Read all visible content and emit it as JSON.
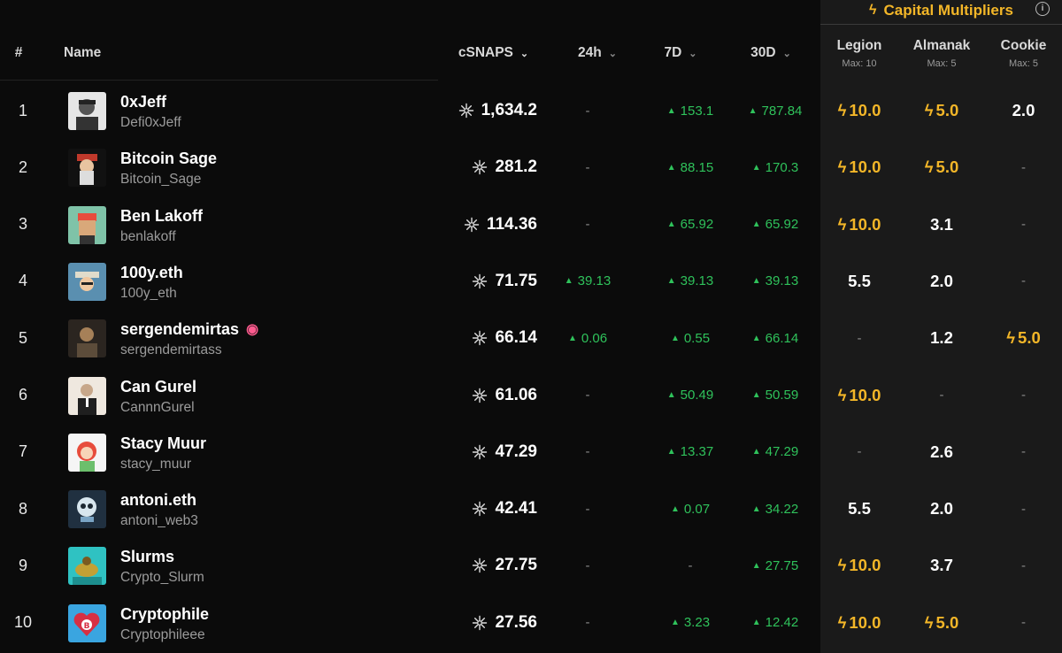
{
  "capital_multipliers": {
    "title": "Capital Multipliers",
    "info_icon": "info-icon",
    "bolt_icon": "lightning-bolt-icon"
  },
  "header": {
    "rank": "#",
    "name": "Name",
    "csnaps": "cSNAPS",
    "h24": "24h",
    "d7": "7D",
    "d30": "30D",
    "legion": "Legion",
    "legion_max": "Max: 10",
    "almanak": "Almanak",
    "almanak_max": "Max: 5",
    "cookie": "Cookie",
    "cookie_max": "Max: 5"
  },
  "colors": {
    "accent": "#f3b628",
    "positive": "#2fc25b",
    "panel": "#1a1a1a",
    "background": "#0b0b0b"
  },
  "rows": [
    {
      "rank": "1",
      "name": "0xJeff",
      "handle": "Defi0xJeff",
      "badge": "",
      "csnaps": "1,634.2",
      "h24": "-",
      "d7": "153.1",
      "d30": "787.84",
      "legion": "10.0",
      "legion_boost": true,
      "almanak": "5.0",
      "almanak_boost": true,
      "cookie": "2.0",
      "cookie_boost": false
    },
    {
      "rank": "2",
      "name": "Bitcoin Sage",
      "handle": "Bitcoin_Sage",
      "badge": "",
      "csnaps": "281.2",
      "h24": "-",
      "d7": "88.15",
      "d30": "170.3",
      "legion": "10.0",
      "legion_boost": true,
      "almanak": "5.0",
      "almanak_boost": true,
      "cookie": "-",
      "cookie_boost": false
    },
    {
      "rank": "3",
      "name": "Ben Lakoff",
      "handle": "benlakoff",
      "badge": "",
      "csnaps": "114.36",
      "h24": "-",
      "d7": "65.92",
      "d30": "65.92",
      "legion": "10.0",
      "legion_boost": true,
      "almanak": "3.1",
      "almanak_boost": false,
      "cookie": "-",
      "cookie_boost": false
    },
    {
      "rank": "4",
      "name": "100y.eth",
      "handle": "100y_eth",
      "badge": "",
      "csnaps": "71.75",
      "h24": "39.13",
      "d7": "39.13",
      "d30": "39.13",
      "legion": "5.5",
      "legion_boost": false,
      "almanak": "2.0",
      "almanak_boost": false,
      "cookie": "-",
      "cookie_boost": false
    },
    {
      "rank": "5",
      "name": "sergendemirtas",
      "handle": "sergendemirtass",
      "badge": "backpack-badge-icon",
      "csnaps": "66.14",
      "h24": "0.06",
      "d7": "0.55",
      "d30": "66.14",
      "legion": "-",
      "legion_boost": false,
      "almanak": "1.2",
      "almanak_boost": false,
      "cookie": "5.0",
      "cookie_boost": true
    },
    {
      "rank": "6",
      "name": "Can Gurel",
      "handle": "CannnGurel",
      "badge": "",
      "csnaps": "61.06",
      "h24": "-",
      "d7": "50.49",
      "d30": "50.59",
      "legion": "10.0",
      "legion_boost": true,
      "almanak": "-",
      "almanak_boost": false,
      "cookie": "-",
      "cookie_boost": false
    },
    {
      "rank": "7",
      "name": "Stacy Muur",
      "handle": "stacy_muur",
      "badge": "",
      "csnaps": "47.29",
      "h24": "-",
      "d7": "13.37",
      "d30": "47.29",
      "legion": "-",
      "legion_boost": false,
      "almanak": "2.6",
      "almanak_boost": false,
      "cookie": "-",
      "cookie_boost": false
    },
    {
      "rank": "8",
      "name": "antoni.eth",
      "handle": "antoni_web3",
      "badge": "",
      "csnaps": "42.41",
      "h24": "-",
      "d7": "0.07",
      "d30": "34.22",
      "legion": "5.5",
      "legion_boost": false,
      "almanak": "2.0",
      "almanak_boost": false,
      "cookie": "-",
      "cookie_boost": false
    },
    {
      "rank": "9",
      "name": "Slurms",
      "handle": "Crypto_Slurm",
      "badge": "",
      "csnaps": "27.75",
      "h24": "-",
      "d7": "-",
      "d30": "27.75",
      "legion": "10.0",
      "legion_boost": true,
      "almanak": "3.7",
      "almanak_boost": false,
      "cookie": "-",
      "cookie_boost": false
    },
    {
      "rank": "10",
      "name": "Cryptophile",
      "handle": "Cryptophileee",
      "badge": "",
      "csnaps": "27.56",
      "h24": "-",
      "d7": "3.23",
      "d30": "12.42",
      "legion": "10.0",
      "legion_boost": true,
      "almanak": "5.0",
      "almanak_boost": true,
      "cookie": "-",
      "cookie_boost": false
    }
  ]
}
